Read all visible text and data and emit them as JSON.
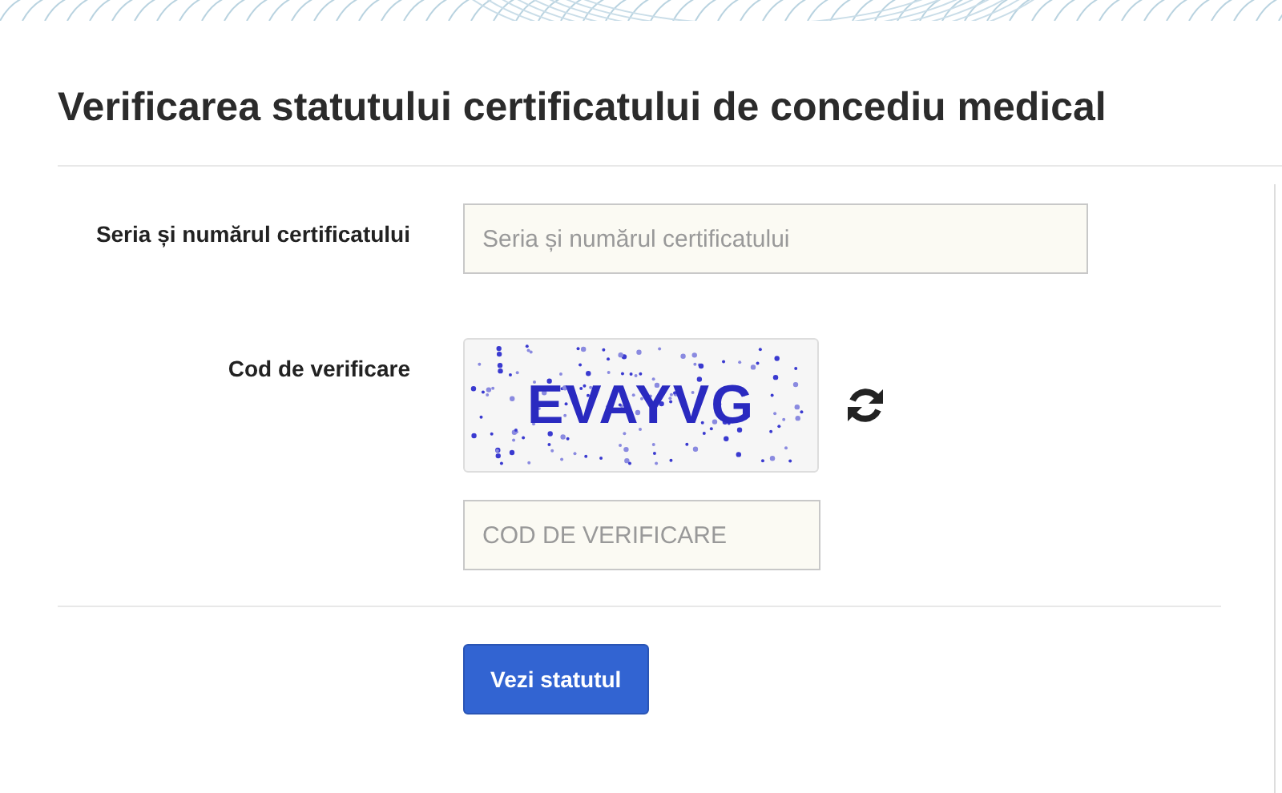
{
  "title": "Verificarea statutului certificatului de concediu medical",
  "fields": [
    {
      "label": "Seria și numărul certificatului",
      "placeholder": "Seria și numărul certificatului"
    }
  ],
  "captcha": {
    "label": "Cod de verificare",
    "code": "EVAYVG",
    "placeholder": "COD DE VERIFICARE"
  },
  "submit": "Vezi statutul"
}
